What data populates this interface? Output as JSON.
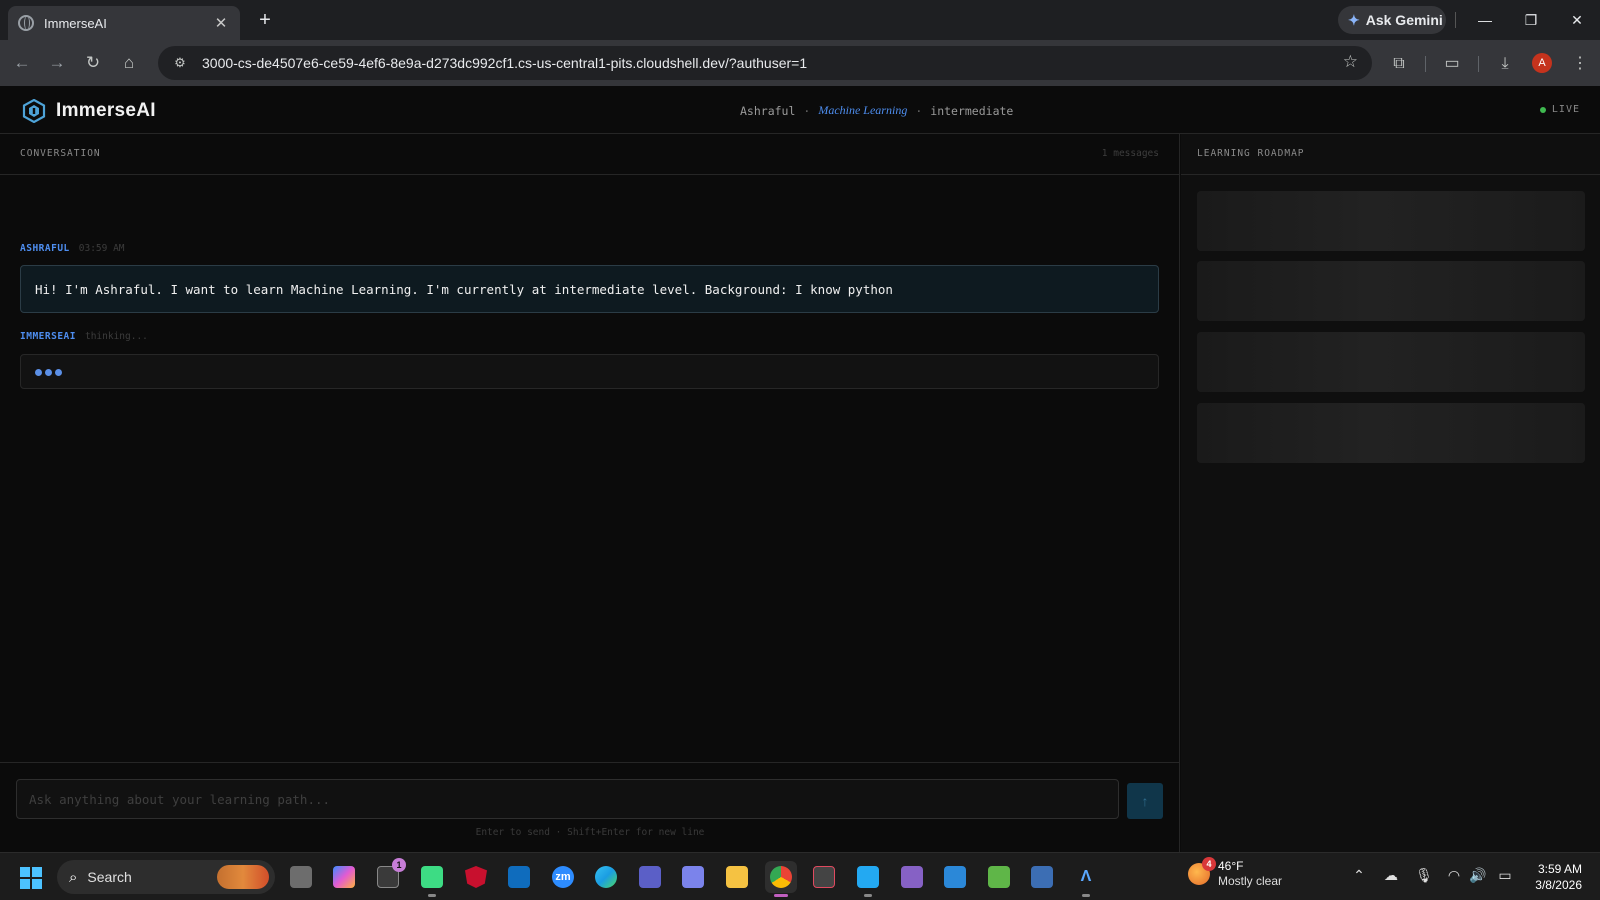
{
  "browser": {
    "tab_title": "ImmerseAI",
    "tab_close": "✕",
    "new_tab": "+",
    "ask_gemini": "Ask Gemini",
    "url": "3000-cs-de4507e6-ce59-4ef6-8e9a-d273dc992cf1.cs-us-central1-pits.cloudshell.dev/?authuser=1",
    "profile_initial": "A"
  },
  "app": {
    "brand": "ImmerseAI",
    "user": "Ashraful",
    "subject": "Machine Learning",
    "level": "intermediate",
    "separator": "·",
    "live_label": "LIVE",
    "conversation_label": "CONVERSATION",
    "message_count": "1 messages",
    "messages": [
      {
        "sender": "ASHRAFUL",
        "time": "03:59 AM",
        "text": "Hi! I'm Ashraful. I want to learn Machine Learning. I'm currently at intermediate level. Background: I know python"
      },
      {
        "sender": "IMMERSEAI",
        "status": "thinking..."
      }
    ],
    "input_placeholder": "Ask anything about your learning path...",
    "send_icon": "↑",
    "hint": "Enter to send · Shift+Enter for new line",
    "roadmap_label": "LEARNING ROADMAP"
  },
  "taskbar": {
    "search_label": "Search",
    "store_badge": "1",
    "weather_badge": "4",
    "temperature": "46°F",
    "condition": "Mostly clear",
    "time": "3:59 AM",
    "date": "3/8/2026"
  },
  "colors": {
    "accent_blue": "#4e8ef0",
    "live_green": "#3fb950",
    "user_bubble": "#0e1a20"
  }
}
